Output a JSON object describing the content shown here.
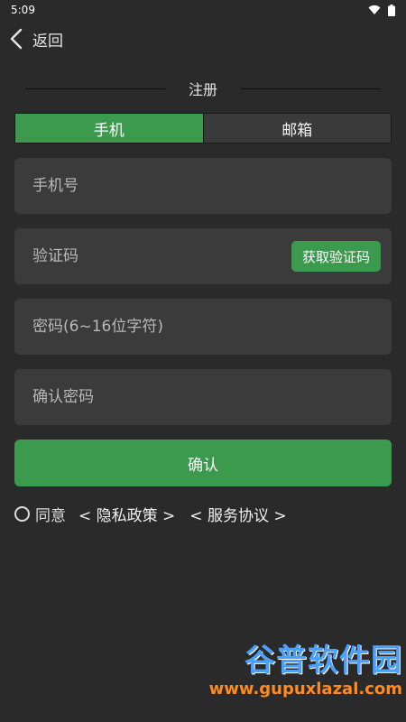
{
  "status_bar": {
    "time": "5:09"
  },
  "header": {
    "back_label": "返回"
  },
  "section_title": "注册",
  "tabs": [
    {
      "label": "手机",
      "active": true
    },
    {
      "label": "邮箱",
      "active": false
    }
  ],
  "form": {
    "phone_placeholder": "手机号",
    "code_placeholder": "验证码",
    "get_code_label": "获取验证码",
    "password_placeholder": "密码(6~16位字符)",
    "confirm_password_placeholder": "确认密码",
    "confirm_label": "确认"
  },
  "agreement": {
    "agree_label": "同意",
    "privacy_link": "< 隐私政策 >",
    "service_link": "< 服务协议 >"
  },
  "watermark": {
    "main": "谷普软件园",
    "sub": "www.gupuxlazal.com"
  },
  "colors": {
    "accent": "#3c9a4f",
    "background": "#2a2a2a",
    "field": "#3b3b3b"
  }
}
